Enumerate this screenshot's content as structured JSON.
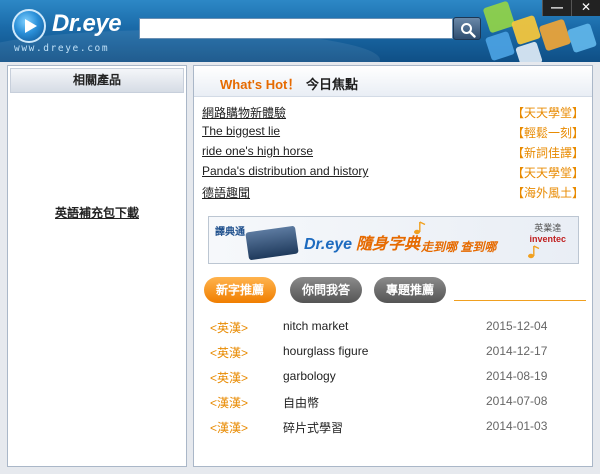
{
  "header": {
    "logo_text": "Dr.eye",
    "logo_url": "www.dreye.com",
    "search_value": ""
  },
  "window_controls": {
    "minimize": "—",
    "close": "✕"
  },
  "left_panel": {
    "title": "相關產品",
    "link": "英語補充包下載"
  },
  "hot": {
    "title": "What's Hot！",
    "subtitle": "今日焦點",
    "items": [
      {
        "title": "網路購物新體驗",
        "category": "【天天學堂】"
      },
      {
        "title": "The biggest lie",
        "category": "【輕鬆一刻】"
      },
      {
        "title": "ride one's high horse",
        "category": "【新詞佳譯】"
      },
      {
        "title": "Panda's distribution and history",
        "category": "【天天學堂】"
      },
      {
        "title": "德語趣聞",
        "category": "【海外風土】"
      }
    ]
  },
  "banner": {
    "brand": "譯典通",
    "main_en": "Dr.eye",
    "main_cn": "隨身字典",
    "tagline": "走到哪 查到哪",
    "corp_cn": "英業達",
    "corp_en": "inventec"
  },
  "tabs": [
    {
      "label": "新字推薦",
      "active": true
    },
    {
      "label": "你問我答",
      "active": false
    },
    {
      "label": "專題推薦",
      "active": false
    }
  ],
  "words": [
    {
      "type": "<英漢>",
      "term": "nitch market",
      "date": "2015-12-04"
    },
    {
      "type": "<英漢>",
      "term": "hourglass figure",
      "date": "2014-12-17"
    },
    {
      "type": "<英漢>",
      "term": "garbology",
      "date": "2014-08-19"
    },
    {
      "type": "<漢漢>",
      "term": "自由幣",
      "date": "2014-07-08"
    },
    {
      "type": "<漢漢>",
      "term": "碎片式學習",
      "date": "2014-01-03"
    }
  ],
  "colors": {
    "accent_orange": "#e88a00",
    "header_blue": "#1a6aa8"
  }
}
